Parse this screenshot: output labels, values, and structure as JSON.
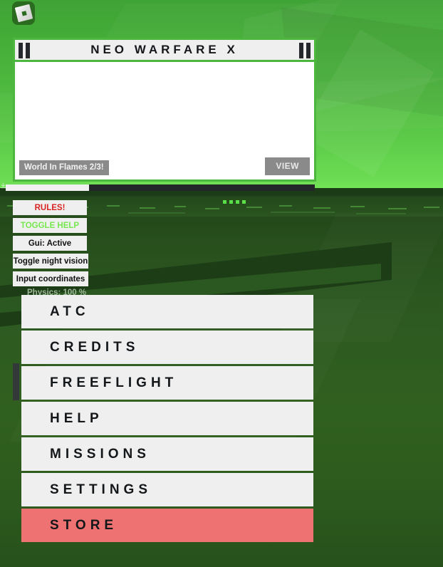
{
  "window": {
    "app": "Roblox",
    "logo_icon": "roblox-logo-icon"
  },
  "scene": {
    "sky_top_color": "#3fa336",
    "sky_horizon_color": "#72e257",
    "ground_color": "#2d5a21",
    "runway_color": "#2a5420",
    "distant_lights_count": 4,
    "light_color": "#5ce04a"
  },
  "notice_panel": {
    "title": "NEO WARFARE X",
    "left_icon": "pause-bars-icon",
    "right_icon": "pause-bars-icon",
    "tag_label": "World In Flames 2/3!",
    "view_label": "VIEW",
    "border_color": "#4cb63f",
    "body_color": "#ffffff",
    "button_color": "#8a8a8a"
  },
  "loading": {
    "progress_percent": 27,
    "fill_color": "#f0f0f0",
    "track_color": "#222628",
    "icon": "download-arrow-icon"
  },
  "tool_buttons": [
    {
      "label": "RULES!",
      "color": "#d92424",
      "width": "narrow"
    },
    {
      "label": "TOGGLE HELP",
      "color": "#76e84f",
      "width": "narrow"
    },
    {
      "label": "Gui: Active",
      "color": "#111111",
      "width": "narrow"
    },
    {
      "label": "Toggle night vision",
      "color": "#111111",
      "width": "wide"
    },
    {
      "label": "Input coordinates",
      "color": "#111111",
      "width": "wide"
    }
  ],
  "status": {
    "physics_label": "Physics: 100 %"
  },
  "main_menu": {
    "active_color": "#ee7272",
    "item_color": "#efefef",
    "items": [
      {
        "label": "ATC",
        "active": false
      },
      {
        "label": "CREDITS",
        "active": false
      },
      {
        "label": "FREEFLIGHT",
        "active": false
      },
      {
        "label": "HELP",
        "active": false
      },
      {
        "label": "MISSIONS",
        "active": false
      },
      {
        "label": "SETTINGS",
        "active": false
      },
      {
        "label": "STORE",
        "active": true
      }
    ],
    "scrollbar": {
      "thumb_color": "#333838"
    }
  }
}
